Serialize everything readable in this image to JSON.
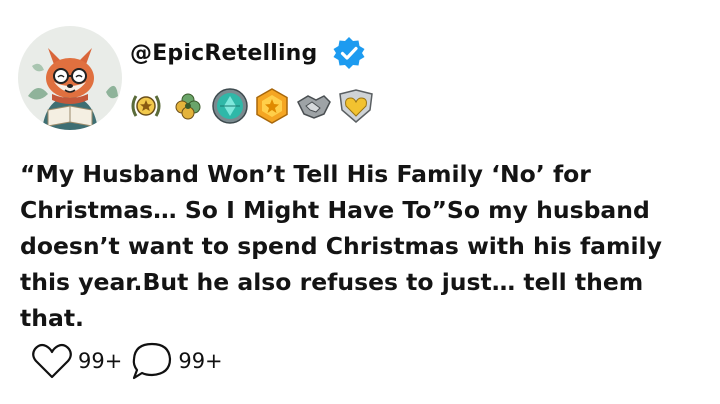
{
  "profile": {
    "handle": "@EpicRetelling",
    "verified": true,
    "avatar_icon": "fox-reading-avatar-icon",
    "badges": [
      "laurel-star-badge-icon",
      "clover-badge-icon",
      "teal-gem-badge-icon",
      "gold-hexagon-badge-icon",
      "handshake-badge-icon",
      "gold-heart-shield-badge-icon"
    ]
  },
  "post": {
    "text": "“My Husband Won’t Tell His Family ‘No’ for Christmas… So I Might Have To”So my husband doesn’t want to spend Christmas with his family this year.But he also refuses to just… tell them that."
  },
  "actions": {
    "like_icon": "heart-icon",
    "like_count": "99+",
    "comment_icon": "comment-bubble-icon",
    "comment_count": "99+"
  },
  "colors": {
    "verified": "#1d9bf0",
    "text": "#141414",
    "background": "#ffffff"
  }
}
